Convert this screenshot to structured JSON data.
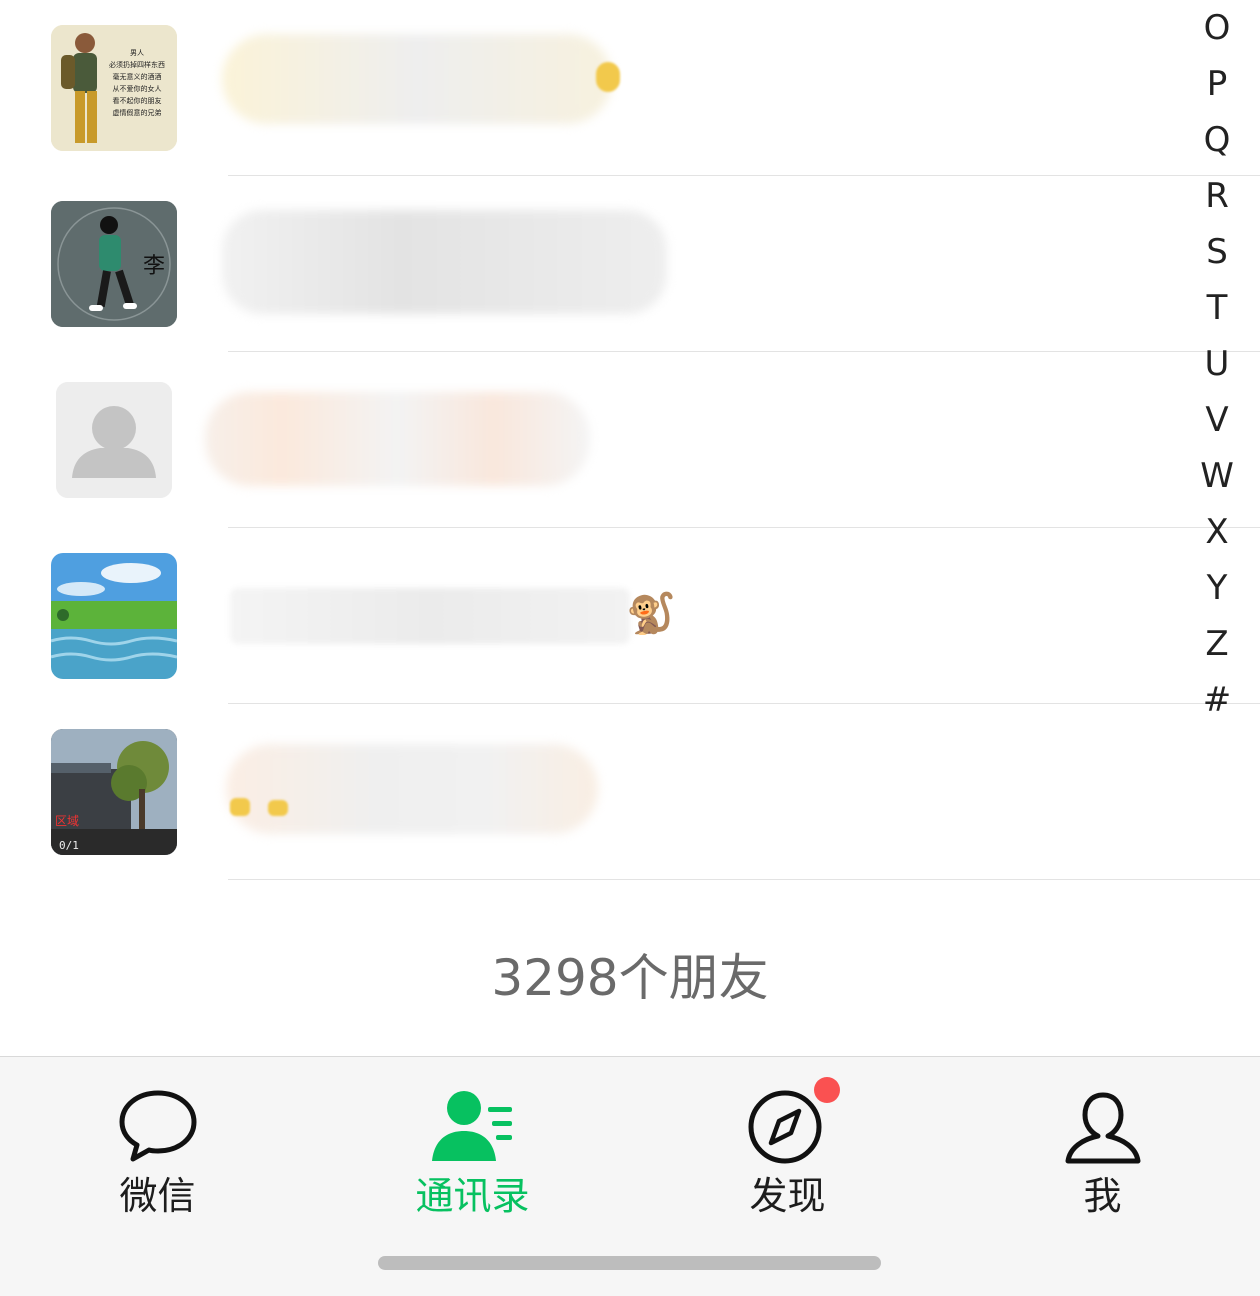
{
  "index_letters": [
    "O",
    "P",
    "Q",
    "R",
    "S",
    "T",
    "U",
    "V",
    "W",
    "X",
    "Y",
    "Z",
    "#"
  ],
  "contacts": [
    {
      "avatar_text": [
        "男人",
        "必须扔掉四样东西",
        "毫无意义的酒酒",
        "从不爱你的女人",
        "看不起你的朋友",
        "虚情假意的兄弟"
      ]
    },
    {
      "avatar_text": [
        "李"
      ]
    },
    {},
    {
      "emoji": "🐒"
    },
    {
      "avatar_text": [
        "区域",
        "0/1"
      ]
    }
  ],
  "footer": {
    "friend_count": "3298个朋友"
  },
  "tabbar": {
    "tabs": [
      {
        "label": "微信",
        "icon": "chat-bubble-icon"
      },
      {
        "label": "通讯录",
        "icon": "contacts-icon",
        "active": true
      },
      {
        "label": "发现",
        "icon": "compass-icon",
        "badge": "dot"
      },
      {
        "label": "我",
        "icon": "person-icon"
      }
    ]
  },
  "colors": {
    "accent": "#07c160",
    "badge": "#fa5151",
    "divider": "#e3e3e3"
  }
}
